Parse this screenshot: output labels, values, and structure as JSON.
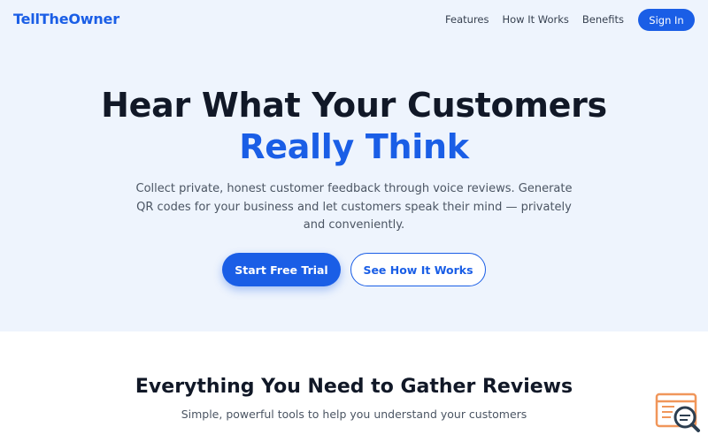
{
  "nav": {
    "brand": "TellTheOwner",
    "links": [
      "Features",
      "How It Works",
      "Benefits"
    ],
    "signin": "Sign In"
  },
  "hero": {
    "title_line1": "Hear What Your Customers",
    "title_line2": "Really Think",
    "description": "Collect private, honest customer feedback through voice reviews. Generate QR codes for your business and let customers speak their mind — privately and conveniently.",
    "primary_cta": "Start Free Trial",
    "secondary_cta": "See How It Works"
  },
  "features": {
    "title": "Everything You Need to Gather Reviews",
    "subtitle": "Simple, powerful tools to help you understand your customers"
  },
  "widget": {
    "icon": "feedback-search-icon"
  },
  "colors": {
    "accent": "#1a5ee6",
    "hero_bg": "#eef4fd",
    "heading": "#111827",
    "body_text": "#4b5563",
    "widget_orange": "#f0965a",
    "widget_teal": "#2c3e50"
  }
}
